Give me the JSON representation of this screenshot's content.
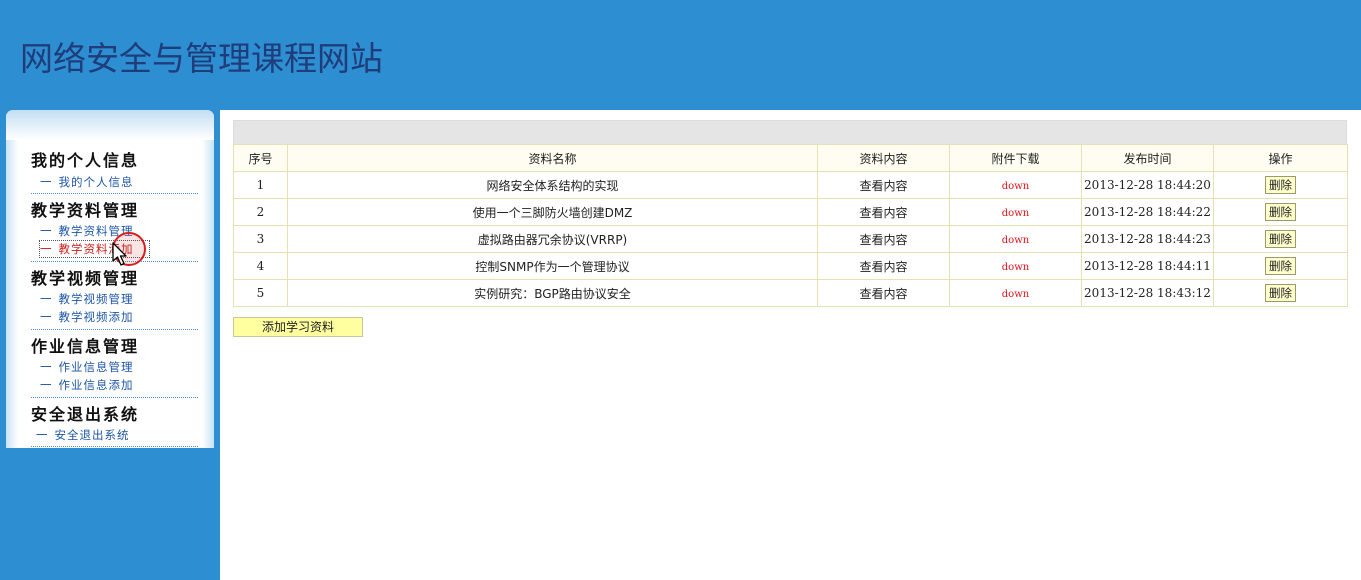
{
  "site": {
    "title": "网络安全与管理课程网站"
  },
  "sidebar": {
    "groups": [
      {
        "title": "我的个人信息",
        "links": [
          "我的个人信息"
        ]
      },
      {
        "title": "教学资料管理",
        "links": [
          "教学资料管理",
          "教学资料添加"
        ]
      },
      {
        "title": "教学视频管理",
        "links": [
          "教学视频管理",
          "教学视频添加"
        ]
      },
      {
        "title": "作业信息管理",
        "links": [
          "作业信息管理",
          "作业信息添加"
        ]
      },
      {
        "title": "安全退出系统",
        "links": [
          "安全退出系统"
        ]
      }
    ],
    "link_prefix": "一"
  },
  "table": {
    "headers": [
      "序号",
      "资料名称",
      "资料内容",
      "附件下载",
      "发布时间",
      "操作"
    ],
    "rows": [
      {
        "no": "1",
        "name": "网络安全体系结构的实现",
        "content": "查看内容",
        "download": "down",
        "time": "2013-12-28 18:44:20",
        "action": "删除"
      },
      {
        "no": "2",
        "name": "使用一个三脚防火墙创建DMZ",
        "content": "查看内容",
        "download": "down",
        "time": "2013-12-28 18:44:22",
        "action": "删除"
      },
      {
        "no": "3",
        "name": "虚拟路由器冗余协议(VRRP)",
        "content": "查看内容",
        "download": "down",
        "time": "2013-12-28 18:44:23",
        "action": "删除"
      },
      {
        "no": "4",
        "name": "控制SNMP作为一个管理协议",
        "content": "查看内容",
        "download": "down",
        "time": "2013-12-28 18:44:11",
        "action": "删除"
      },
      {
        "no": "5",
        "name": "实例研究：BGP路由协议安全",
        "content": "查看内容",
        "download": "down",
        "time": "2013-12-28 18:43:12",
        "action": "删除"
      }
    ]
  },
  "add_button": {
    "label": "添加学习资料"
  },
  "colors": {
    "header_bg": "#2d8fd2",
    "title": "#1f3d7a",
    "link": "#1d56a5",
    "active_link": "#c8201c",
    "download": "#e0141c",
    "button_bg": "#ffffcc"
  }
}
